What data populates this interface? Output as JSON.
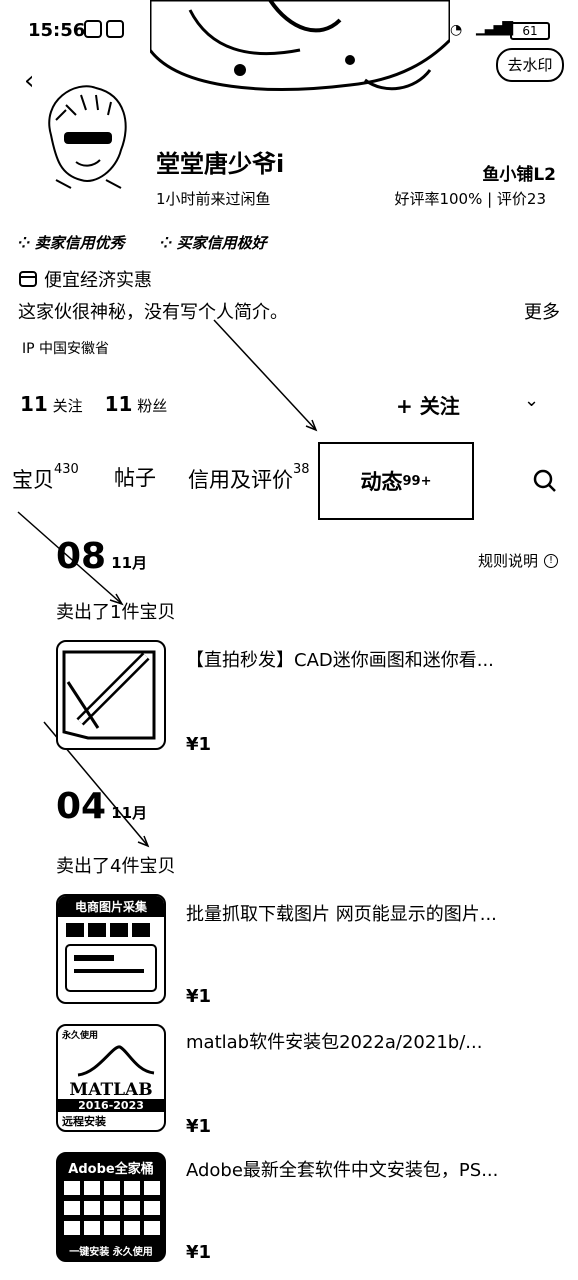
{
  "status": {
    "time": "15:56",
    "battery": "61"
  },
  "header": {
    "watermark_btn": "去水印"
  },
  "profile": {
    "name": "堂堂唐少爷i",
    "level": "鱼小铺L2",
    "last_seen": "1小时前来过闲鱼",
    "rating": "好评率100% | 评价23",
    "badges": [
      "卖家信用优秀",
      "买家信用极好"
    ],
    "tag": "便宜经济实惠",
    "bio": "这家伙很神秘，没有写个人简介。",
    "more": "更多",
    "ip": "IP  中国安徽省",
    "following_count": "11",
    "following_label": "关注",
    "fans_count": "11",
    "fans_label": "粉丝",
    "follow_button": "+ 关注"
  },
  "tabs": [
    {
      "label": "宝贝",
      "count": "430"
    },
    {
      "label": "帖子",
      "count": ""
    },
    {
      "label": "信用及评价",
      "count": "38"
    },
    {
      "label": "动态",
      "count": "99+"
    }
  ],
  "feed": {
    "rules": "规则说明",
    "groups": [
      {
        "day": "08",
        "month": "11月",
        "summary": "卖出了1件宝贝",
        "items": [
          {
            "title": "【直拍秒发】CAD迷你画图和迷你看...",
            "price": "¥1"
          }
        ]
      },
      {
        "day": "04",
        "month": "11月",
        "summary": "卖出了4件宝贝",
        "items": [
          {
            "title": "批量抓取下载图片 网页能显示的图片...",
            "price": "¥1",
            "thumb_text": [
              "电商图片采集"
            ]
          },
          {
            "title": "matlab软件安装包2022a/2021b/...",
            "price": "¥1",
            "thumb_text": [
              "永久使用",
              "MATLAB",
              "2016-2023",
              "远程安装"
            ]
          },
          {
            "title": "Adobe最新全套软件中文安装包，PS...",
            "price": "¥1",
            "thumb_text": [
              "Adobe全家桶",
              "一键安装 永久使用"
            ]
          }
        ]
      }
    ]
  }
}
